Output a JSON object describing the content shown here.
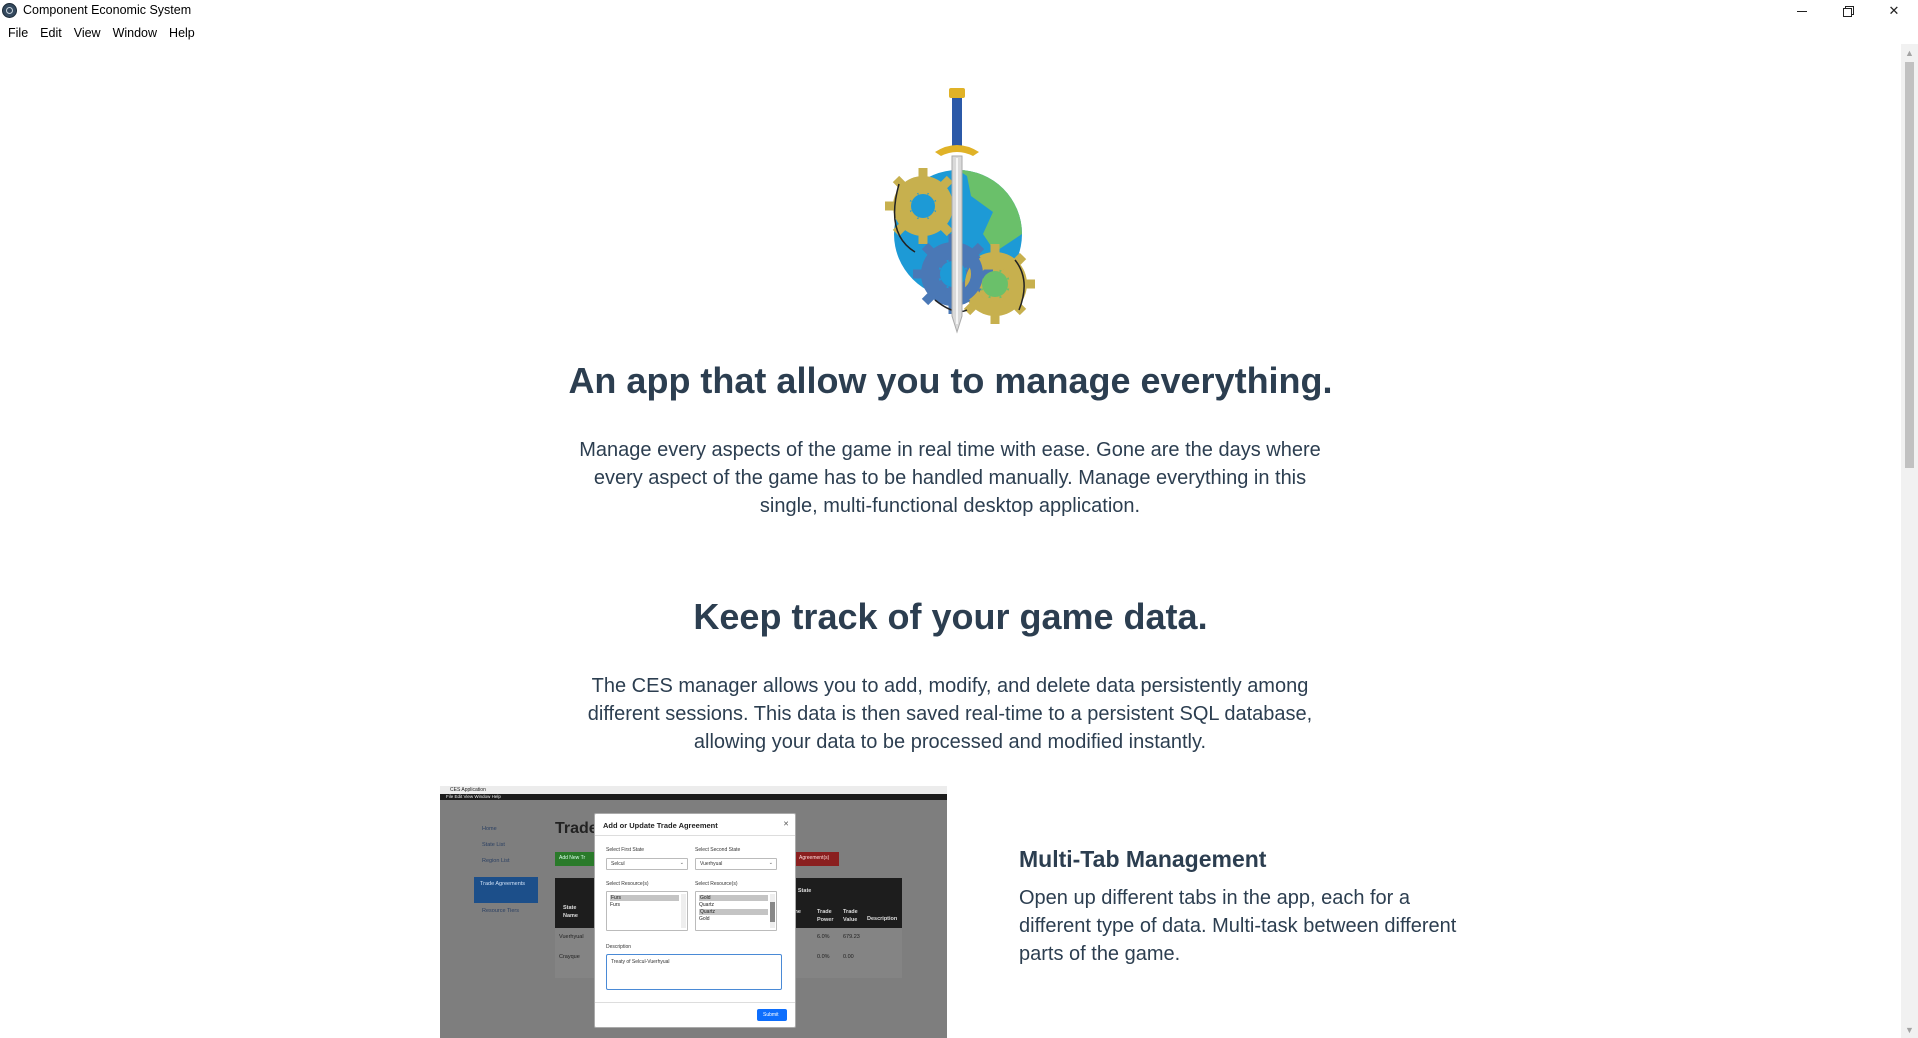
{
  "window": {
    "title": "Component Economic System",
    "icon": "app-globe-icon"
  },
  "menu": {
    "items": [
      "File",
      "Edit",
      "View",
      "Window",
      "Help"
    ]
  },
  "hero": {
    "logo": "sword-gears-globe-logo",
    "title": "An app that allow you to manage everything.",
    "description": "Manage every aspects of the game in real time with ease. Gone are the days where every aspect of the game has to be handled manually. Manage everything in this single, multi-functional desktop application."
  },
  "section": {
    "title": "Keep track of your game data.",
    "description": "The CES manager allows you to add, modify, and delete data persistently among different sessions. This data is then saved real-time to a persistent SQL database, allowing your data to be processed and modified instantly."
  },
  "feature": {
    "title": "Multi-Tab Management",
    "description": "Open up different tabs in the app, each for a different type of data. Multi-task between different parts of the game."
  },
  "screenshot": {
    "app_title": "CES Application",
    "menu": "File  Edit  View  Window  Help",
    "nav": [
      "Home",
      "State List",
      "Region List",
      "Trade Agreements",
      "Resource Tiers"
    ],
    "page_heading": "Trade",
    "add_button": "Add New Tr",
    "delete_button": "Agreement(s)",
    "table_headers": [
      "State Name",
      "d State",
      "me d",
      "Trade Power",
      "Trade Value",
      "Description"
    ],
    "table_rows": [
      {
        "state": "Vuerhyual",
        "power": "6.0%",
        "value": "679.23"
      },
      {
        "state": "Crayque",
        "power": "0.0%",
        "value": "0.00"
      }
    ],
    "modal": {
      "title": "Add or Update Trade Agreement",
      "first_state_label": "Select First State",
      "first_state_value": "Selcul",
      "second_state_label": "Select Second State",
      "second_state_value": "Vuerhyual",
      "resources_label_1": "Select Resource(s)",
      "resources_1": [
        "Furs",
        "Furs"
      ],
      "resources_label_2": "Select Resource(s)",
      "resources_2": [
        "Gold",
        "Quartz",
        "Quartz",
        "Gold"
      ],
      "description_label": "Description",
      "description_value": "Treaty of Selcul-Vuerhyual",
      "submit": "Submit"
    }
  },
  "colors": {
    "text": "#2c3e50",
    "scrollbar_track": "#f1f1f1",
    "scrollbar_thumb": "#c1c1c1",
    "submit": "#0d6efd"
  }
}
